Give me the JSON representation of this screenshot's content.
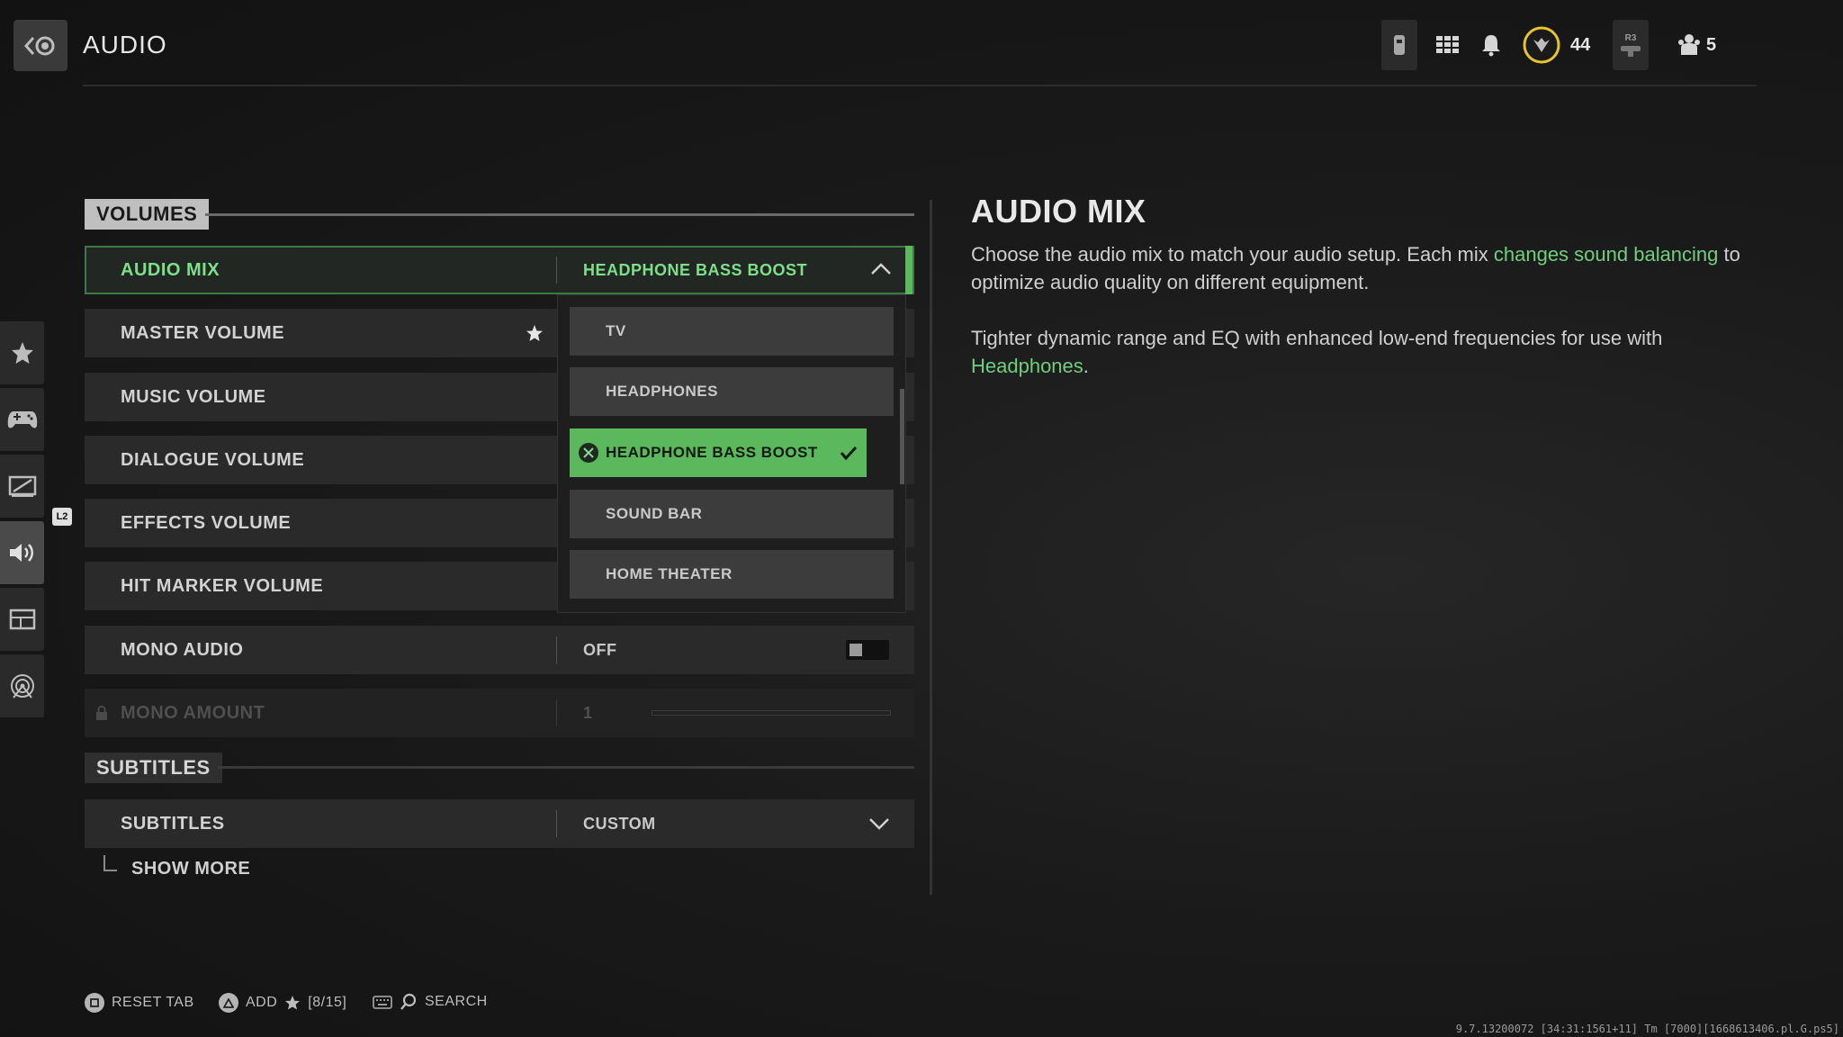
{
  "header": {
    "title": "AUDIO",
    "rank_level": "44",
    "friends_count": "5",
    "r3_label": "R3"
  },
  "sidebar": {
    "items": [
      "favorites-icon",
      "controller-icon",
      "graphics-icon",
      "audio-icon",
      "interface-icon",
      "network-icon"
    ],
    "l2_label": "L2"
  },
  "sections": {
    "volumes": "VOLUMES",
    "subtitles": "SUBTITLES"
  },
  "settings": {
    "audio_mix": {
      "label": "AUDIO MIX",
      "value": "HEADPHONE BASS BOOST"
    },
    "master_volume": {
      "label": "MASTER VOLUME"
    },
    "music_volume": {
      "label": "MUSIC VOLUME"
    },
    "dialogue_volume": {
      "label": "DIALOGUE VOLUME"
    },
    "effects_volume": {
      "label": "EFFECTS VOLUME"
    },
    "hit_marker_volume": {
      "label": "HIT MARKER VOLUME"
    },
    "mono_audio": {
      "label": "MONO AUDIO",
      "value": "OFF"
    },
    "mono_amount": {
      "label": "MONO AMOUNT",
      "value": "1",
      "slider_level": 0.0
    },
    "subtitles": {
      "label": "SUBTITLES",
      "value": "CUSTOM"
    },
    "show_more": "SHOW MORE"
  },
  "dropdown": {
    "options": [
      "TV",
      "HEADPHONES",
      "HEADPHONE BASS BOOST",
      "SOUND BAR",
      "HOME THEATER"
    ],
    "selected": "HEADPHONE BASS BOOST"
  },
  "info": {
    "title": "AUDIO MIX",
    "p1_a": "Choose the audio mix to match your audio setup. Each mix ",
    "p1_hl": "changes sound balancing",
    "p1_b": " to optimize audio quality on different equipment.",
    "p2_a": "Tighter dynamic range and EQ with enhanced low-end frequencies for use with ",
    "p2_hl": "Headphones",
    "p2_b": "."
  },
  "footer": {
    "reset": "RESET TAB",
    "add": "ADD",
    "add_count": "[8/15]",
    "search": "SEARCH"
  },
  "build_info": "9.7.13200072 [34:31:1561+11] Tm [7000][1668613406.pl.G.ps5]",
  "colors": {
    "accent_green": "#5cb85c",
    "highlight_green": "#6fcf7c"
  }
}
